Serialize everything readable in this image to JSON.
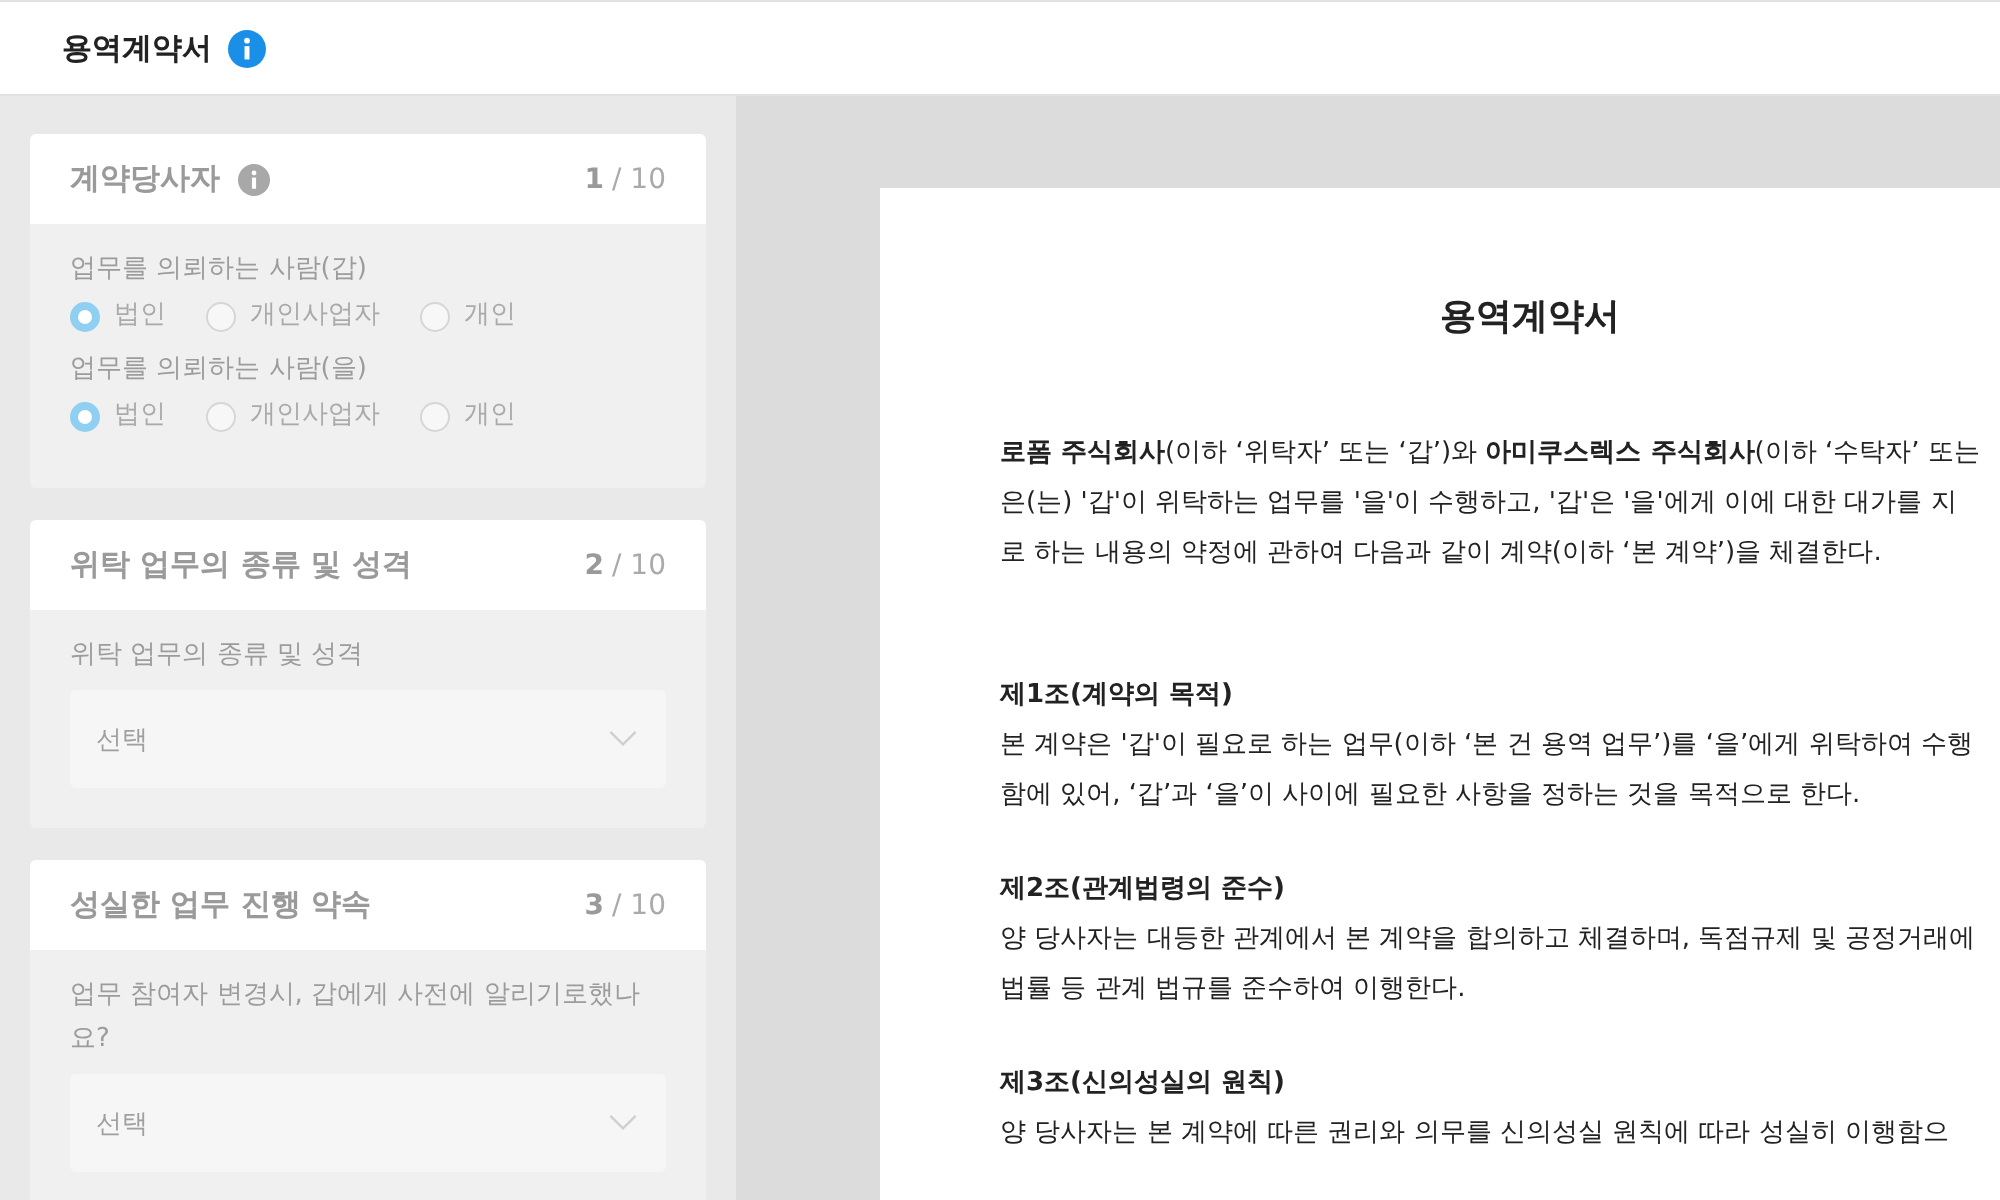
{
  "header": {
    "title": "용역계약서",
    "info": true
  },
  "cards": [
    {
      "title": "계약당사자",
      "info": true,
      "step": "1",
      "total": "/ 10",
      "fields": [
        {
          "kind": "radio",
          "label": "업무를 의뢰하는 사람(갑)",
          "options": [
            {
              "label": "법인",
              "selected": true
            },
            {
              "label": "개인사업자",
              "selected": false
            },
            {
              "label": "개인",
              "selected": false
            }
          ]
        },
        {
          "kind": "radio",
          "label": "업무를 의뢰하는 사람(을)",
          "options": [
            {
              "label": "법인",
              "selected": true
            },
            {
              "label": "개인사업자",
              "selected": false
            },
            {
              "label": "개인",
              "selected": false
            }
          ]
        }
      ]
    },
    {
      "title": "위탁 업무의 종류 및 성격",
      "info": false,
      "step": "2",
      "total": "/ 10",
      "fields": [
        {
          "kind": "select",
          "label": "위탁 업무의 종류 및 성격",
          "placeholder": "선택"
        }
      ]
    },
    {
      "title": "성실한 업무 진행 약속",
      "info": false,
      "step": "3",
      "total": "/ 10",
      "fields": [
        {
          "kind": "select",
          "label": "업무 참여자 변경시, 갑에게 사전에 알리기로했나요?",
          "placeholder": "선택"
        }
      ]
    }
  ],
  "document": {
    "title": "용역계약서",
    "intro": [
      "**로폼 주식회사**(이하 ‘위탁자’ 또는 ‘갑’)와 **아미쿠스렉스 주식회사**(이하 ‘수탁자’ 또는",
      "은(는) '갑'이 위탁하는 업무를 '을'이 수행하고, '갑'은 '을'에게 이에 대한 대가를 지",
      "로 하는 내용의 약정에 관하여 다음과 같이 계약(이하 ‘본 계약’)을 체결한다."
    ],
    "articles": [
      {
        "heading": "제1조(계약의 목적)",
        "lines": [
          "본 계약은 '갑'이 필요로 하는 업무(이하 ‘본 건 용역 업무’)를 ‘을’에게 위탁하여 수행",
          "함에 있어, ‘갑’과 ‘을’이 사이에 필요한 사항을 정하는 것을 목적으로 한다."
        ]
      },
      {
        "heading": "제2조(관계법령의 준수)",
        "lines": [
          "양 당사자는 대등한 관계에서 본 계약을 합의하고 체결하며, 독점규제 및 공정거래에",
          "법률 등 관계 법규를 준수하여 이행한다."
        ]
      },
      {
        "heading": "제3조(신의성실의 원칙)",
        "lines": [
          "양 당사자는 본 계약에 따른 권리와 의무를 신의성실 원칙에 따라 성실히 이행함으"
        ]
      }
    ]
  }
}
